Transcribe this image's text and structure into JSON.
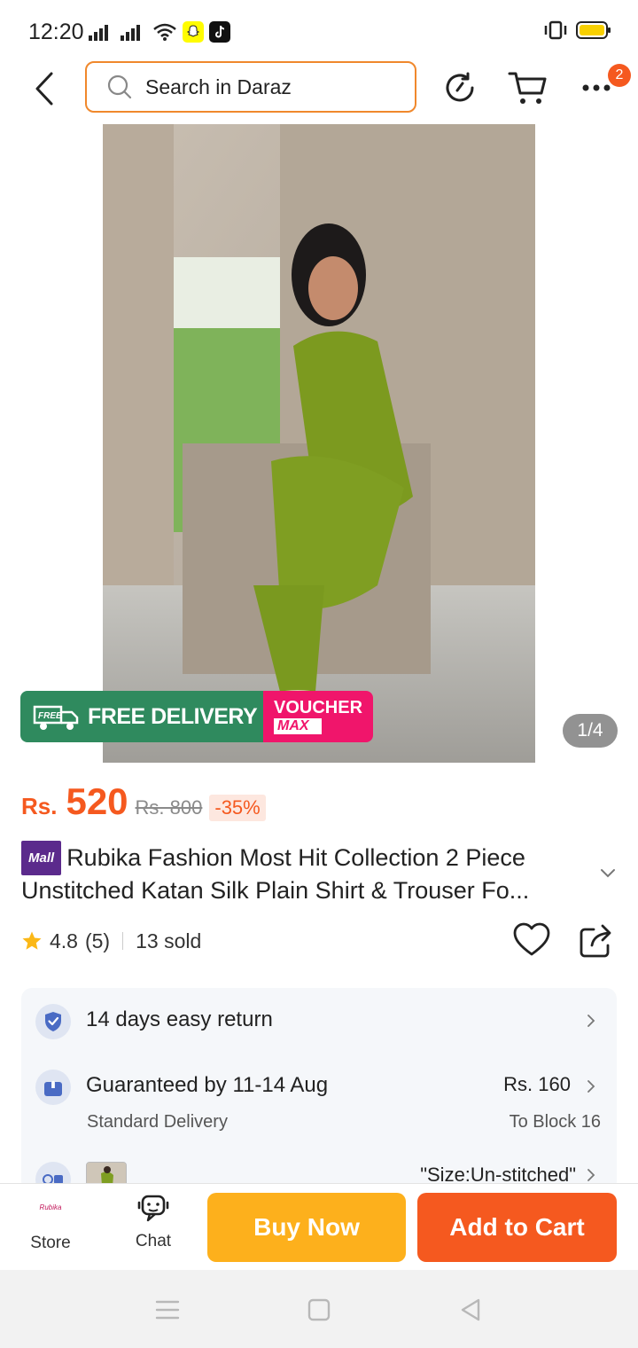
{
  "status_bar": {
    "time": "12:20"
  },
  "search": {
    "placeholder": "Search in Daraz"
  },
  "header": {
    "cart_badge": "2"
  },
  "gallery": {
    "promo_free": "FREE DELIVERY",
    "promo_free_tag": "FREE",
    "promo_voucher": "VOUCHER",
    "promo_voucher_sub": "MAX",
    "counter": "1/4"
  },
  "price": {
    "currency": "Rs.",
    "current": "520",
    "original": "Rs. 800",
    "discount": "-35%"
  },
  "product": {
    "mall_tag": "Mall",
    "title": "Rubika Fashion Most Hit Collection 2 Piece Unstitched Katan Silk Plain Shirt & Trouser Fo..."
  },
  "rating": {
    "value": "4.8",
    "count": "(5)",
    "sold": "13 sold"
  },
  "info": {
    "returns_label": "14 days easy return",
    "delivery_label": "Guaranteed by 11-14 Aug",
    "delivery_sub": "Standard Delivery",
    "delivery_price": "Rs. 160",
    "delivery_location": "To Block 16",
    "variant_text": "\"Size:Un-stitched\""
  },
  "action_bar": {
    "store_label": "Store",
    "store_logo_text": "Rubika",
    "chat_label": "Chat",
    "buy_now_label": "Buy Now",
    "add_to_cart_label": "Add to Cart"
  },
  "colors": {
    "accent": "#f5591f",
    "buy_now": "#fdb01c",
    "search_border": "#f0882c",
    "free_delivery": "#2f8a5e",
    "voucher": "#f0156b"
  }
}
